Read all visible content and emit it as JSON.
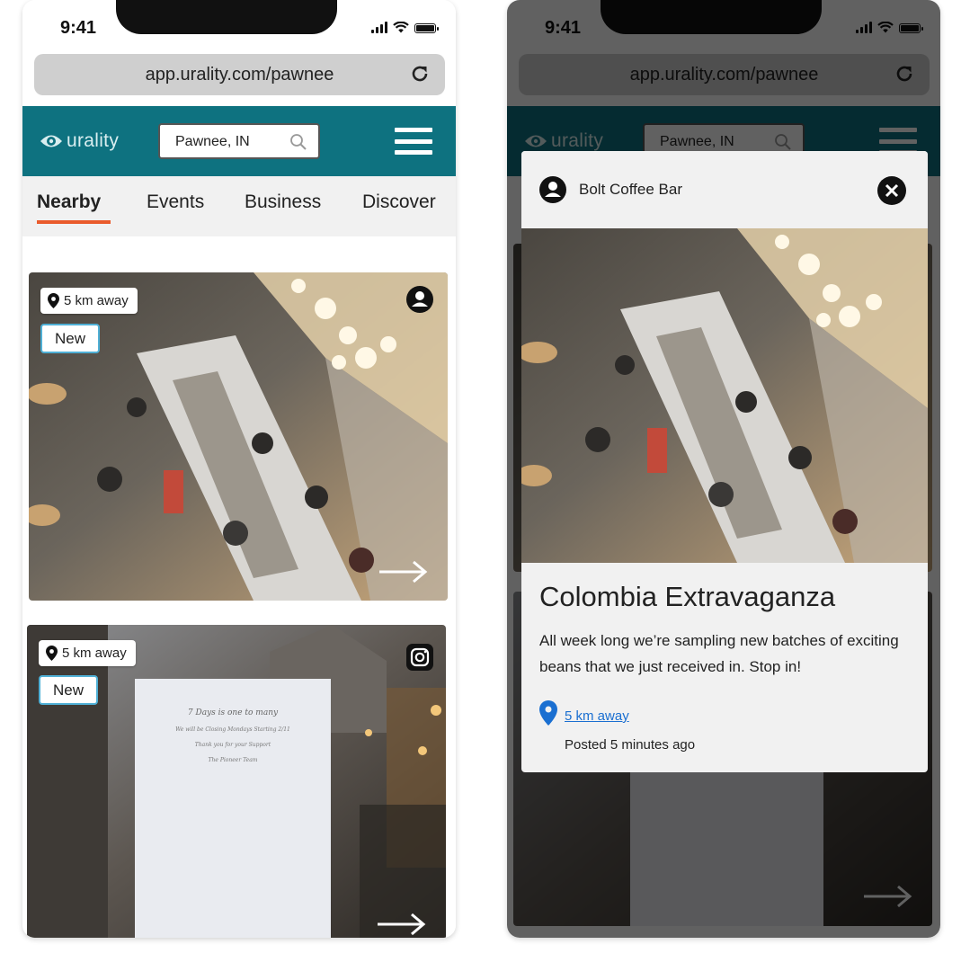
{
  "statusbar": {
    "time": "9:41"
  },
  "browser": {
    "url": "app.urality.com/pawnee"
  },
  "appbar": {
    "logo_text": "urality",
    "search_value": "Pawnee, IN"
  },
  "tabs": [
    {
      "label": "Nearby",
      "active": true
    },
    {
      "label": "Events",
      "active": false
    },
    {
      "label": "Business",
      "active": false
    },
    {
      "label": "Discover",
      "active": false
    }
  ],
  "feed": {
    "cards": [
      {
        "distance": "5 km away",
        "badge": "New",
        "source_icon": "user-icon",
        "arrow_icon": "arrow-right-icon"
      },
      {
        "distance": "5 km away",
        "badge": "New",
        "source_icon": "instagram-icon",
        "arrow_icon": "arrow-right-icon"
      }
    ]
  },
  "modal": {
    "business_name": "Bolt Coffee Bar",
    "title": "Colombia Extravaganza",
    "description": "All week long we’re sampling new batches of exciting beans that we just received in. Stop in!",
    "distance": "5 km away",
    "posted": "Posted 5 minutes ago"
  },
  "colors": {
    "appbar": "#0e7280",
    "tab_underline": "#ea5b2c",
    "badge_border": "#4fb0d6",
    "link": "#1a6fd1",
    "overlay": "#000000"
  }
}
